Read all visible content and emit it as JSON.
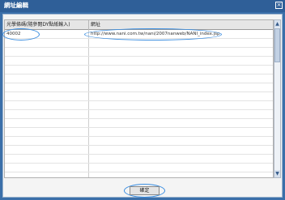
{
  "window": {
    "title": "網址編輯",
    "close_icon": "close-icon"
  },
  "grid": {
    "columns": [
      "光學條碼(隨參閱DY點紙輸入)",
      "網址"
    ],
    "rows": [
      {
        "code": "40002",
        "url": "http://www.nani.com.tw/nani/2007nanweb/NANI_index.jsp"
      },
      {
        "code": "",
        "url": ""
      },
      {
        "code": "",
        "url": ""
      },
      {
        "code": "",
        "url": ""
      },
      {
        "code": "",
        "url": ""
      },
      {
        "code": "",
        "url": ""
      },
      {
        "code": "",
        "url": ""
      },
      {
        "code": "",
        "url": ""
      },
      {
        "code": "",
        "url": ""
      },
      {
        "code": "",
        "url": ""
      },
      {
        "code": "",
        "url": ""
      },
      {
        "code": "",
        "url": ""
      },
      {
        "code": "",
        "url": ""
      },
      {
        "code": "",
        "url": ""
      },
      {
        "code": "",
        "url": ""
      },
      {
        "code": "",
        "url": ""
      },
      {
        "code": "",
        "url": ""
      }
    ]
  },
  "scrollbar": {
    "up_icon": "chevron-up-icon",
    "down_icon": "chevron-down-icon"
  },
  "footer": {
    "ok_label": "確定"
  },
  "colors": {
    "titlebar": "#2f5f98",
    "highlight": "#3a8de0"
  }
}
